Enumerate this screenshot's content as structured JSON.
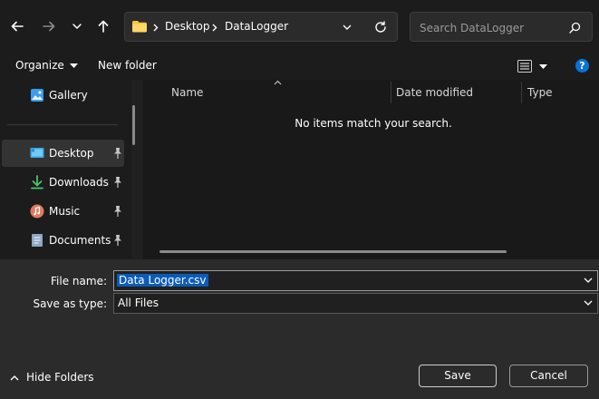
{
  "nav": {
    "back_icon": "arrow-left-icon",
    "forward_icon": "arrow-right-icon",
    "recent_icon": "chevron-down-icon",
    "up_icon": "arrow-up-icon"
  },
  "address": {
    "folder_icon": "folder-icon",
    "breadcrumbs": [
      "Desktop",
      "DataLogger"
    ],
    "refresh_icon": "refresh-icon"
  },
  "search": {
    "placeholder": "Search DataLogger",
    "icon": "search-icon"
  },
  "commands": {
    "organize": "Organize",
    "new_folder": "New folder",
    "view_icon": "view-list-icon",
    "help_icon": "help-icon",
    "help_label": "?"
  },
  "sidebar": {
    "items": [
      {
        "label": "Gallery",
        "icon": "gallery-icon",
        "pinned": false
      },
      {
        "label": "Desktop",
        "icon": "desktop-icon",
        "pinned": true,
        "selected": true
      },
      {
        "label": "Downloads",
        "icon": "download-icon",
        "pinned": true
      },
      {
        "label": "Music",
        "icon": "music-icon",
        "pinned": true
      },
      {
        "label": "Documents",
        "icon": "documents-icon",
        "pinned": true
      }
    ]
  },
  "filelist": {
    "columns": [
      "Name",
      "Date modified",
      "Type"
    ],
    "sort_icon": "sort-up-icon",
    "empty_message": "No items match your search."
  },
  "form": {
    "filename_label": "File name:",
    "filename_value": "Data Logger.csv",
    "savetype_label": "Save as type:",
    "savetype_value": "All Files"
  },
  "footer": {
    "hide_folders": "Hide Folders",
    "save": "Save",
    "cancel": "Cancel"
  },
  "colors": {
    "background": "#202020",
    "accent": "#0b5cb8",
    "help": "#0a74d6"
  }
}
